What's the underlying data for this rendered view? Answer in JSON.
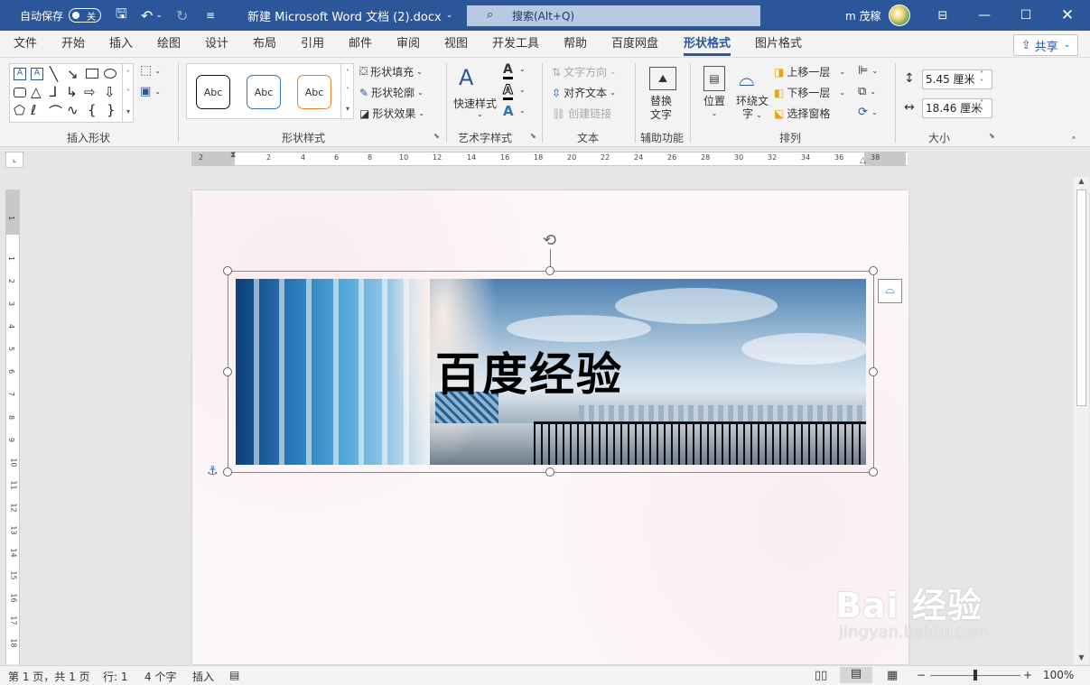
{
  "titlebar": {
    "autosave_label": "自动保存",
    "autosave_state": "关",
    "document_title": "新建 Microsoft Word 文档 (2).docx",
    "search_placeholder": "搜索(Alt+Q)",
    "user_name": "m 茂稼"
  },
  "tabs": [
    "文件",
    "开始",
    "插入",
    "绘图",
    "设计",
    "布局",
    "引用",
    "邮件",
    "审阅",
    "视图",
    "开发工具",
    "帮助",
    "百度网盘",
    "形状格式",
    "图片格式"
  ],
  "active_tab": "形状格式",
  "share_label": "共享",
  "ribbon": {
    "groups": {
      "insert_shapes": "插入形状",
      "shape_styles": "形状样式",
      "wordart_styles": "艺术字样式",
      "text": "文本",
      "accessibility": "辅助功能",
      "arrange": "排列",
      "size": "大小"
    },
    "style_samples": [
      "Abc",
      "Abc",
      "Abc"
    ],
    "shape_fill": "形状填充",
    "shape_outline": "形状轮廓",
    "shape_effects": "形状效果",
    "quick_styles": "快速样式",
    "text_direction": "文字方向",
    "align_text": "对齐文本",
    "create_link": "创建链接",
    "alt_text_line1": "替换",
    "alt_text_line2": "文字",
    "position": "位置",
    "wrap_text_line1": "环绕文",
    "wrap_text_line2": "字",
    "bring_forward": "上移一层",
    "send_backward": "下移一层",
    "selection_pane": "选择窗格",
    "height_value": "5.45 厘米",
    "width_value": "18.46 厘米"
  },
  "hruler_labels": [
    "2",
    "2",
    "4",
    "6",
    "8",
    "10",
    "12",
    "14",
    "16",
    "18",
    "20",
    "22",
    "24",
    "26",
    "28",
    "30",
    "32",
    "34",
    "36",
    "38"
  ],
  "vruler_labels": [
    "1",
    "1",
    "2",
    "3",
    "4",
    "5",
    "6",
    "7",
    "8",
    "9",
    "10",
    "11",
    "12",
    "13",
    "14",
    "15",
    "16",
    "17",
    "18"
  ],
  "document": {
    "image_caption": "百度经验"
  },
  "status": {
    "page": "第 1 页，共 1 页",
    "lines": "行: 1",
    "words": "4 个字",
    "mode": "插入",
    "zoom": "100%"
  },
  "watermark": {
    "big": "Bai 经验",
    "small": "jingyan.baidu.com"
  }
}
